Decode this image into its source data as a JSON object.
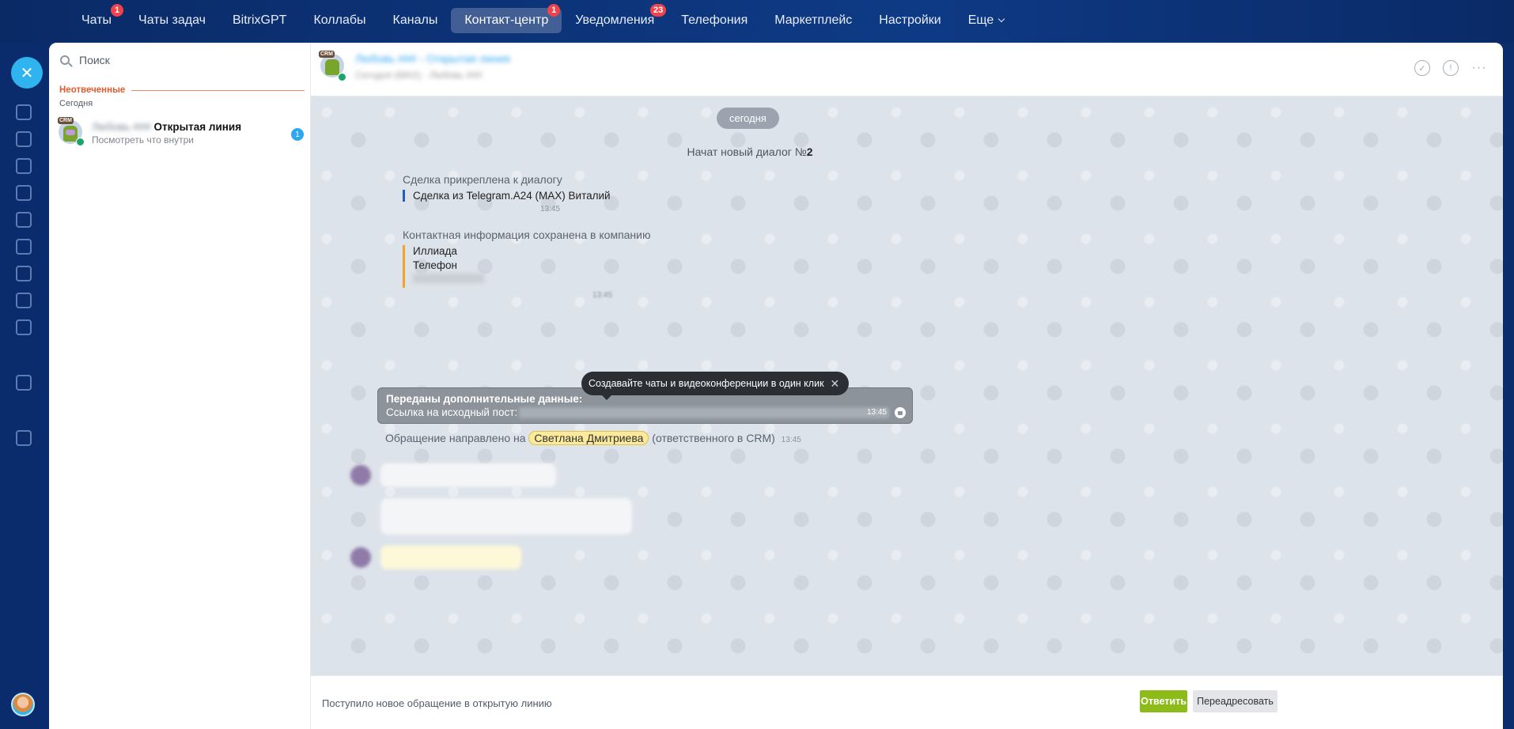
{
  "topnav": {
    "items": [
      {
        "label": "Чаты",
        "badge": "1"
      },
      {
        "label": "Чаты задач",
        "badge": ""
      },
      {
        "label": "BitrixGPT",
        "badge": ""
      },
      {
        "label": "Коллабы",
        "badge": ""
      },
      {
        "label": "Каналы",
        "badge": ""
      },
      {
        "label": "Контакт-центр",
        "badge": "1",
        "active": true
      },
      {
        "label": "Уведомления",
        "badge": "23"
      },
      {
        "label": "Телефония",
        "badge": ""
      },
      {
        "label": "Маркетплейс",
        "badge": ""
      },
      {
        "label": "Настройки",
        "badge": ""
      },
      {
        "label": "Еще",
        "badge": ""
      }
    ]
  },
  "left": {
    "search_placeholder": "Поиск",
    "section_title": "Неотвеченные",
    "section_sub": "Сегодня",
    "chat": {
      "crm_tag": "CRM",
      "name_blurred": "Любовь ###",
      "name_bold": "Открытая линия",
      "preview": "Посмотреть что внутри",
      "unread": "1"
    }
  },
  "header": {
    "crm_tag": "CRM",
    "title_blurred": "Любовь ### - Открытая линия",
    "sub_blurred": "Сегодня (МАХ) · Любовь ###"
  },
  "messages": {
    "date": "сегодня",
    "new_dialog_prefix": "Начат новый диалог №",
    "new_dialog_num": "2",
    "deal_title": "Сделка прикреплена к диалогу",
    "deal_quote": "Сделка из Telegram.A24 (MAX) Виталий",
    "deal_time": "13:45",
    "contact_title": "Контактная информация сохранена в компанию",
    "contact_company": "Иллиада",
    "contact_phone_label": "Телефон",
    "contact_time": "13:45",
    "tooltip": "Создавайте чаты и видеоконференции в один клик",
    "extra_line1": "Переданы дополнительные данные:",
    "extra_line2": "Ссылка на исходный пост:",
    "extra_time": "13:45",
    "routed_prefix": "Обращение направлено на",
    "routed_name": "Светлана Дмитриева",
    "routed_suffix": "(ответственного в CRM)",
    "routed_time": "13:45"
  },
  "footer": {
    "text": "Поступило новое обращение в открытую линию",
    "reply": "Ответить",
    "forward": "Переадресовать"
  },
  "colors": {
    "accent": "#2fb4ef",
    "reply_button": "#8dbb1a",
    "badge": "#f0424b",
    "highlight": "#fbe99c"
  }
}
